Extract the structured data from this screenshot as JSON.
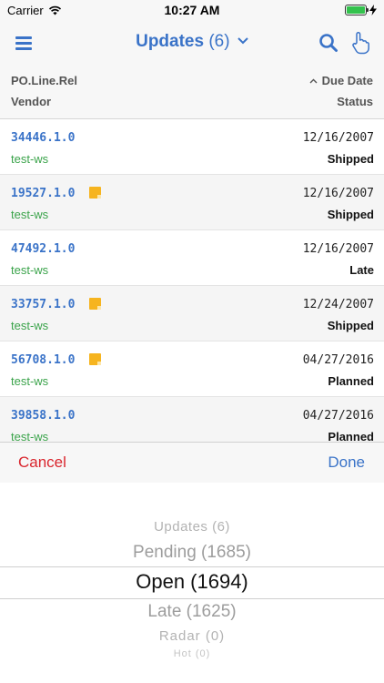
{
  "status_bar": {
    "carrier": "Carrier",
    "time": "10:27 AM",
    "battery_level": 1.0,
    "battery_color": "#33c24d"
  },
  "nav": {
    "title": "Updates",
    "count": "(6)",
    "accent": "#3a73c8"
  },
  "columns": {
    "top_left": "PO.Line.Rel",
    "bottom_left": "Vendor",
    "top_right": "Due Date",
    "bottom_right": "Status"
  },
  "rows": [
    {
      "po": "34446.1.0",
      "has_note": false,
      "vendor": "test-ws",
      "date": "12/16/2007",
      "status": "Shipped"
    },
    {
      "po": "19527.1.0",
      "has_note": true,
      "vendor": "test-ws",
      "date": "12/16/2007",
      "status": "Shipped"
    },
    {
      "po": "47492.1.0",
      "has_note": false,
      "vendor": "test-ws",
      "date": "12/16/2007",
      "status": "Late"
    },
    {
      "po": "33757.1.0",
      "has_note": true,
      "vendor": "test-ws",
      "date": "12/24/2007",
      "status": "Shipped"
    },
    {
      "po": "56708.1.0",
      "has_note": true,
      "vendor": "test-ws",
      "date": "04/27/2016",
      "status": "Planned"
    },
    {
      "po": "39858.1.0",
      "has_note": false,
      "vendor": "test-ws",
      "date": "04/27/2016",
      "status": "Planned"
    }
  ],
  "picker": {
    "cancel_label": "Cancel",
    "done_label": "Done",
    "options": [
      "Updates (6)",
      "Pending (1685)",
      "Open (1694)",
      "Late (1625)",
      "Radar (0)",
      "Hot (0)"
    ],
    "selected": "Open (1694)"
  }
}
